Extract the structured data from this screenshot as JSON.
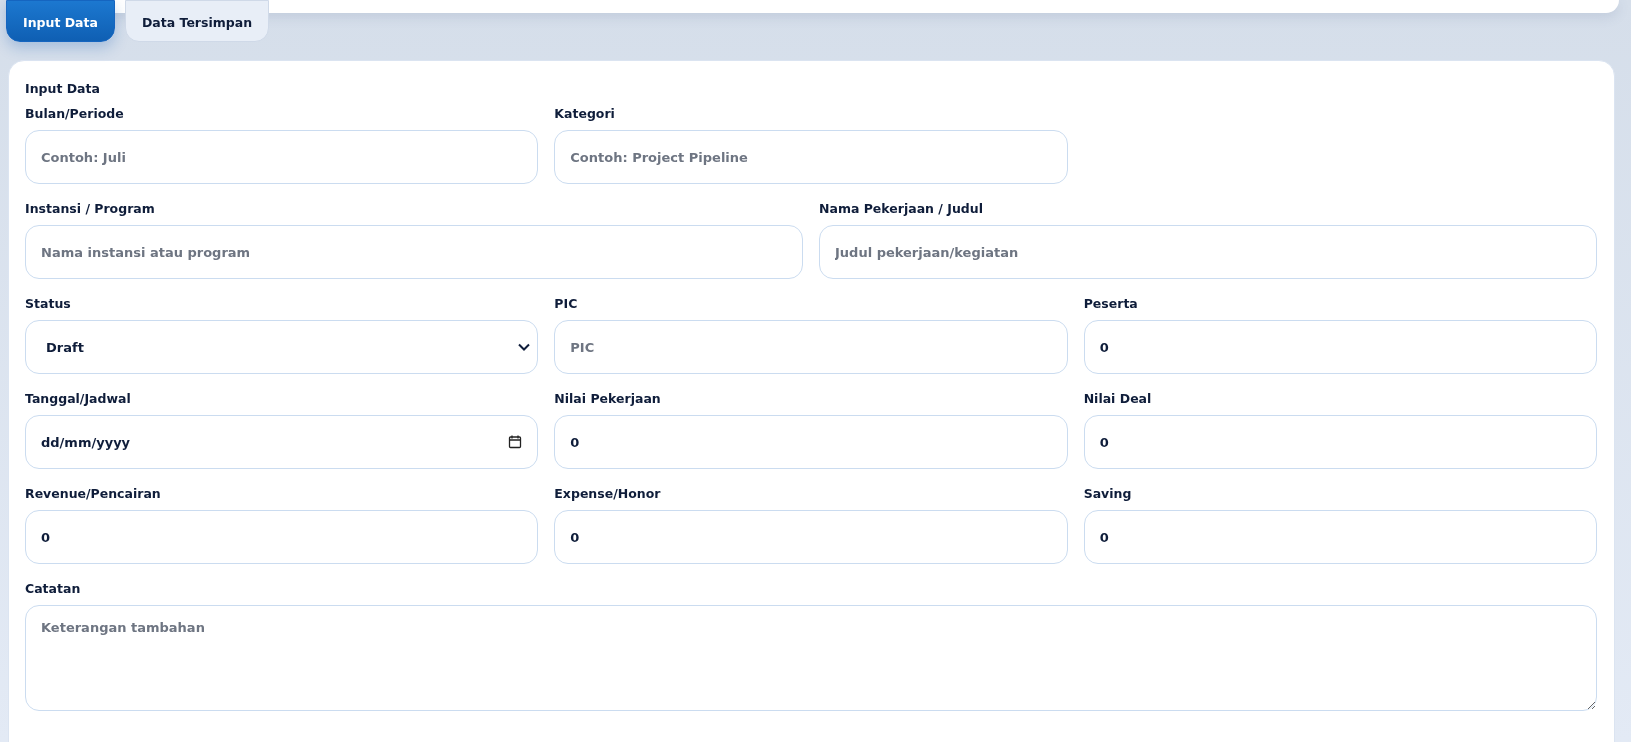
{
  "tabs": [
    {
      "label": "Input Data",
      "selected": true
    },
    {
      "label": "Data Tersimpan",
      "selected": false
    }
  ],
  "form": {
    "title": "Input Data",
    "rows": [
      [
        {
          "label": "Bulan/Periode",
          "kind": "text",
          "placeholder": "Contoh: Juli"
        },
        {
          "label": "Kategori",
          "kind": "text",
          "placeholder": "Contoh: Project Pipeline"
        }
      ],
      [
        {
          "label": "Instansi / Program",
          "kind": "text",
          "placeholder": "Nama instansi atau program"
        },
        {
          "label": "Nama Pekerjaan / Judul",
          "kind": "text",
          "placeholder": "Judul pekerjaan/kegiatan"
        }
      ],
      [
        {
          "label": "Status",
          "kind": "select",
          "value": "Draft"
        },
        {
          "label": "PIC",
          "kind": "text",
          "placeholder": "PIC"
        },
        {
          "label": "Peserta",
          "kind": "text",
          "value": "0"
        }
      ],
      [
        {
          "label": "Tanggal/Jadwal",
          "kind": "date",
          "value": "dd/mm/yyyy"
        },
        {
          "label": "Nilai Pekerjaan",
          "kind": "text",
          "value": "0"
        },
        {
          "label": "Nilai Deal",
          "kind": "text",
          "value": "0"
        }
      ],
      [
        {
          "label": "Revenue/Pencairan",
          "kind": "text",
          "value": "0"
        },
        {
          "label": "Expense/Honor",
          "kind": "text",
          "value": "0"
        },
        {
          "label": "Saving",
          "kind": "text",
          "value": "0"
        }
      ],
      [
        {
          "label": "Catatan",
          "kind": "textarea",
          "placeholder": "Keterangan tambahan"
        }
      ]
    ]
  }
}
